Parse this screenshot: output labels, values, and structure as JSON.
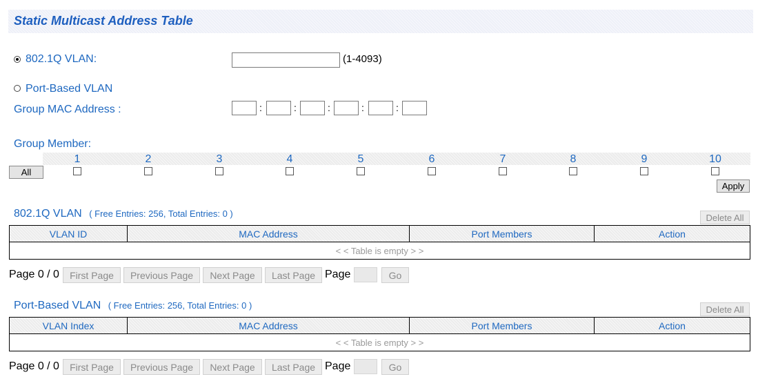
{
  "title": "Static Multicast Address Table",
  "vlan_form": {
    "dot1q_label": "802.1Q VLAN:",
    "dot1q_value": "",
    "dot1q_range": "(1-4093)",
    "port_based_label": "Port-Based VLAN",
    "group_mac_label": "Group MAC Address :",
    "mac_octets": [
      "",
      "",
      "",
      "",
      "",
      ""
    ],
    "mac_separator": ":"
  },
  "group_member": {
    "label": "Group Member:",
    "all_button": "All",
    "ports": [
      "1",
      "2",
      "3",
      "4",
      "5",
      "6",
      "7",
      "8",
      "9",
      "10"
    ],
    "apply_button": "Apply"
  },
  "dot1q_section": {
    "title": "802.1Q VLAN",
    "subtitle": "( Free Entries: 256, Total Entries: 0 )",
    "delete_all": "Delete All",
    "columns": [
      "VLAN ID",
      "MAC Address",
      "Port Members",
      "Action"
    ],
    "empty_text": "< < Table is empty > >",
    "pager": {
      "page_status": "Page 0 / 0",
      "first": "First Page",
      "previous": "Previous Page",
      "next": "Next Page",
      "last": "Last Page",
      "page_label": "Page",
      "page_value": "",
      "go": "Go"
    }
  },
  "port_section": {
    "title": "Port-Based VLAN",
    "subtitle": "( Free Entries: 256, Total Entries: 0 )",
    "delete_all": "Delete All",
    "columns": [
      "VLAN Index",
      "MAC Address",
      "Port Members",
      "Action"
    ],
    "empty_text": "< < Table is empty > >",
    "pager": {
      "page_status": "Page 0 / 0",
      "first": "First Page",
      "previous": "Previous Page",
      "next": "Next Page",
      "last": "Last Page",
      "page_label": "Page",
      "page_value": "",
      "go": "Go"
    }
  }
}
